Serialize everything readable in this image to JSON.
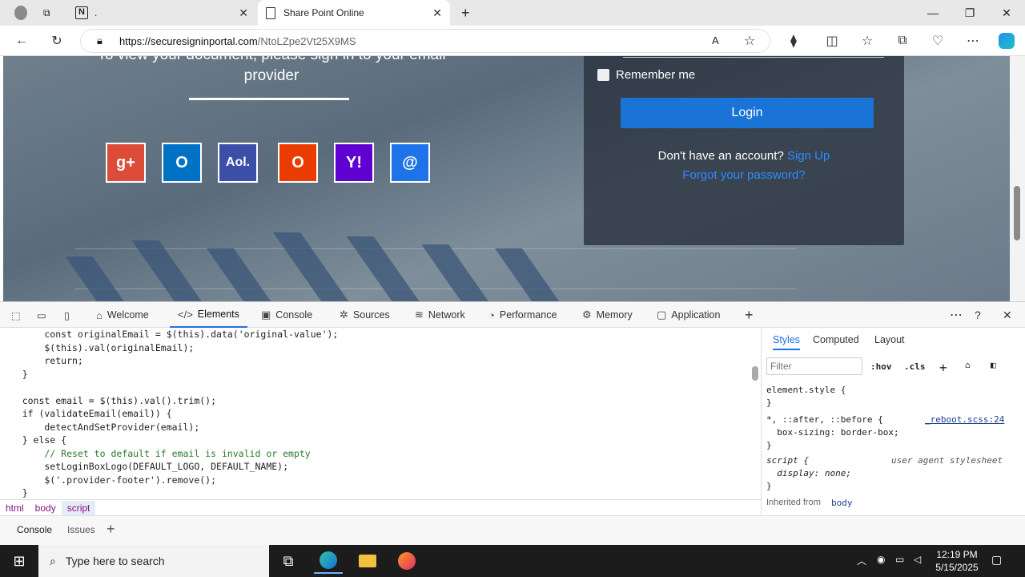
{
  "browser": {
    "tabs": [
      {
        "title": "."
      },
      {
        "title": "Share Point Online"
      }
    ],
    "url_host": "https://securesigninportal.com",
    "url_path": "/NtoLZpe2Vt25X9MS"
  },
  "page": {
    "heading_line1": "To view your document, please sign in to your email",
    "heading_line2": "provider",
    "providers": [
      {
        "name": "google-plus-icon",
        "label": "g+",
        "color": "#dd4b39"
      },
      {
        "name": "outlook-icon",
        "label": "O",
        "color": "#0072c6"
      },
      {
        "name": "aol-icon",
        "label": "Aol.",
        "color": "#3c4fa8"
      },
      {
        "name": "office-icon",
        "label": "O",
        "color": "#eb3c00"
      },
      {
        "name": "yahoo-icon",
        "label": "Y!",
        "color": "#5f01d1"
      },
      {
        "name": "other-mail-icon",
        "label": "@",
        "color": "#1e73e8"
      }
    ],
    "remember_label": "Remember me",
    "login_label": "Login",
    "no_account_text": "Don't have an account?",
    "sign_up_label": "Sign Up",
    "forgot_label": "Forgot your password?"
  },
  "devtools": {
    "tabs": [
      {
        "label": "Welcome",
        "icon": "home-icon"
      },
      {
        "label": "Elements",
        "icon": "code-icon"
      },
      {
        "label": "Console",
        "icon": "console-icon"
      },
      {
        "label": "Sources",
        "icon": "bug-icon"
      },
      {
        "label": "Network",
        "icon": "wifi-icon"
      },
      {
        "label": "Performance",
        "icon": "gauge-icon"
      },
      {
        "label": "Memory",
        "icon": "chip-icon"
      },
      {
        "label": "Application",
        "icon": "window-icon"
      }
    ],
    "code_lines": [
      "        const originalEmail = $(this).data('original-value');",
      "        $(this).val(originalEmail);",
      "        return;",
      "    }",
      "",
      "    const email = $(this).val().trim();",
      "    if (validateEmail(email)) {",
      "        detectAndSetProvider(email);",
      "    } else {",
      "        // Reset to default if email is invalid or empty",
      "        setLoginBoxLogo(DEFAULT_LOGO, DEFAULT_NAME);",
      "        $('.provider-footer').remove();",
      "    }"
    ],
    "breadcrumb": [
      "html",
      "body",
      "script"
    ],
    "styles_tabs": [
      "Styles",
      "Computed",
      "Layout"
    ],
    "filter_placeholder": "Filter",
    "hov_label": ":hov",
    "cls_label": ".cls",
    "style_rules": [
      "element.style {",
      "}",
      "*, ::after, ::before {",
      "  box-sizing: border-box;",
      "}",
      "script {",
      "  display: none;",
      "}"
    ],
    "reboot_link": "_reboot.scss:24",
    "user_agent_label": "user agent stylesheet",
    "inherited_label": "Inherited from",
    "inherited_from": "body",
    "drawer_tabs": [
      "Console",
      "Issues"
    ]
  },
  "taskbar": {
    "search_placeholder": "Type here to search",
    "time": "12:19 PM",
    "date": "5/15/2025"
  }
}
